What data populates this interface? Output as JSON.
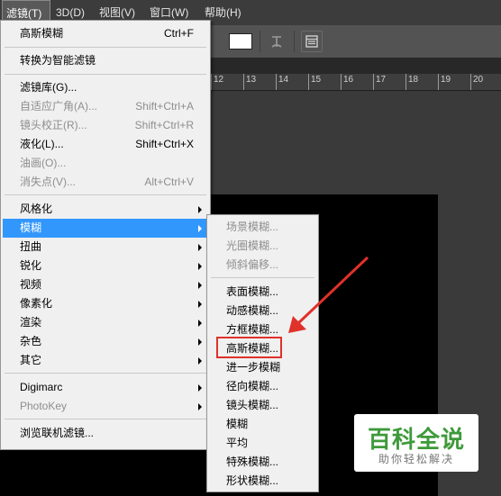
{
  "menubar": {
    "items": [
      {
        "label": "滤镜(T)"
      },
      {
        "label": "3D(D)"
      },
      {
        "label": "视图(V)"
      },
      {
        "label": "窗口(W)"
      },
      {
        "label": "帮助(H)"
      }
    ]
  },
  "ruler": {
    "ticks": [
      "12",
      "13",
      "14",
      "15",
      "16",
      "17",
      "18",
      "19",
      "20"
    ]
  },
  "filter_menu": {
    "items": [
      {
        "label": "高斯模糊",
        "shortcut": "Ctrl+F"
      },
      {
        "label": "转换为智能滤镜"
      },
      {
        "label": "滤镜库(G)..."
      },
      {
        "label": "自适应广角(A)...",
        "shortcut": "Shift+Ctrl+A",
        "disabled": true
      },
      {
        "label": "镜头校正(R)...",
        "shortcut": "Shift+Ctrl+R",
        "disabled": true
      },
      {
        "label": "液化(L)...",
        "shortcut": "Shift+Ctrl+X"
      },
      {
        "label": "油画(O)...",
        "disabled": true
      },
      {
        "label": "消失点(V)...",
        "shortcut": "Alt+Ctrl+V",
        "disabled": true
      },
      {
        "label": "风格化",
        "submenu": true
      },
      {
        "label": "模糊",
        "submenu": true,
        "highlighted": true
      },
      {
        "label": "扭曲",
        "submenu": true
      },
      {
        "label": "锐化",
        "submenu": true
      },
      {
        "label": "视频",
        "submenu": true
      },
      {
        "label": "像素化",
        "submenu": true
      },
      {
        "label": "渲染",
        "submenu": true
      },
      {
        "label": "杂色",
        "submenu": true
      },
      {
        "label": "其它",
        "submenu": true
      },
      {
        "label": "Digimarc",
        "submenu": true
      },
      {
        "label": "PhotoKey",
        "submenu": true,
        "disabled": true
      },
      {
        "label": "浏览联机滤镜..."
      }
    ]
  },
  "blur_menu": {
    "items": [
      {
        "label": "场景模糊...",
        "disabled": true
      },
      {
        "label": "光圈模糊...",
        "disabled": true
      },
      {
        "label": "倾斜偏移...",
        "disabled": true
      },
      {
        "label": "表面模糊..."
      },
      {
        "label": "动感模糊..."
      },
      {
        "label": "方框模糊..."
      },
      {
        "label": "高斯模糊...",
        "annotated": true
      },
      {
        "label": "进一步模糊"
      },
      {
        "label": "径向模糊..."
      },
      {
        "label": "镜头模糊..."
      },
      {
        "label": "模糊"
      },
      {
        "label": "平均"
      },
      {
        "label": "特殊模糊..."
      },
      {
        "label": "形状模糊..."
      }
    ]
  },
  "watermark": {
    "title": "百科全说",
    "subtitle": "助你轻松解决"
  },
  "colors": {
    "highlight": "#3297fd",
    "annotation": "#e0312a",
    "watermark_green": "#3e9a3a"
  }
}
